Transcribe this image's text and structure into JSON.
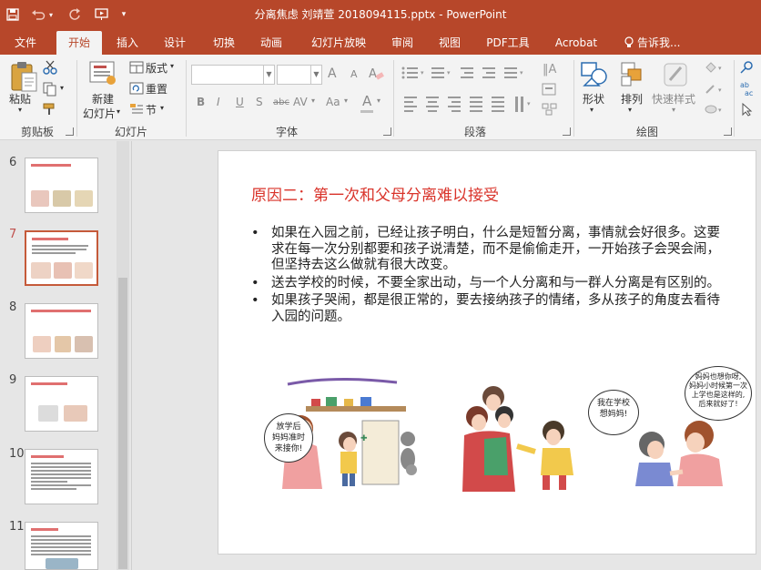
{
  "window": {
    "title": "分离焦虑 刘靖萱 2018094115.pptx - PowerPoint"
  },
  "quick_access": {
    "save_icon": "save-icon",
    "undo_icon": "undo-icon",
    "redo_icon": "redo-icon",
    "present_icon": "present-from-start-icon",
    "customize_icon": "customize-qat-icon"
  },
  "tabs": [
    {
      "label": "文件"
    },
    {
      "label": "开始"
    },
    {
      "label": "插入"
    },
    {
      "label": "设计"
    },
    {
      "label": "切换"
    },
    {
      "label": "动画"
    },
    {
      "label": "幻灯片放映"
    },
    {
      "label": "审阅"
    },
    {
      "label": "视图"
    },
    {
      "label": "PDF工具"
    },
    {
      "label": "Acrobat"
    },
    {
      "label": "告诉我..."
    }
  ],
  "ribbon": {
    "clipboard": {
      "group_label": "剪贴板",
      "paste_label": "粘贴"
    },
    "slides": {
      "group_label": "幻灯片",
      "new_slide_label_1": "新建",
      "new_slide_label_2": "幻灯片",
      "layout_label": "版式",
      "reset_label": "重置",
      "section_label": "节"
    },
    "font": {
      "group_label": "字体",
      "font_name_value": "",
      "font_size_value": "",
      "bold": "B",
      "italic": "I",
      "underline": "U",
      "shadow": "S",
      "strike": "abc",
      "spacing": "AV",
      "case": "Aa",
      "font_color": "A",
      "grow": "A",
      "shrink": "A"
    },
    "paragraph": {
      "group_label": "段落"
    },
    "drawing": {
      "group_label": "绘图",
      "shapes_label": "形状",
      "arrange_label": "排列",
      "quick_styles_label": "快速样式"
    }
  },
  "thumbnails": [
    {
      "number": "6"
    },
    {
      "number": "7"
    },
    {
      "number": "8"
    },
    {
      "number": "9"
    },
    {
      "number": "10"
    },
    {
      "number": "11"
    }
  ],
  "slide": {
    "title": "原因二：第一次和父母分离难以接受",
    "bullets": [
      "如果在入园之前，已经让孩子明白，什么是短暂分离，事情就会好很多。这要求在每一次分别都要和孩子说清楚，而不是偷偷走开，一开始孩子会哭会闹，但坚持去这么做就有很大改变。",
      "送去学校的时候，不要全家出动，与一个人分离和与一群人分离是有区别的。",
      "如果孩子哭闹，都是很正常的，要去接纳孩子的情绪，多从孩子的角度去看待入园的问题。"
    ],
    "bubbles": [
      "放学后\n妈妈准时\n来接你!",
      "我在学校\n想妈妈!",
      "妈妈也想你呀,\n妈妈小时候第一次\n上学也是这样的,\n后来就好了!"
    ]
  },
  "colors": {
    "accent": "#b7472a",
    "slide_title": "#d9332a",
    "active_thumb": "#c55a3a"
  }
}
